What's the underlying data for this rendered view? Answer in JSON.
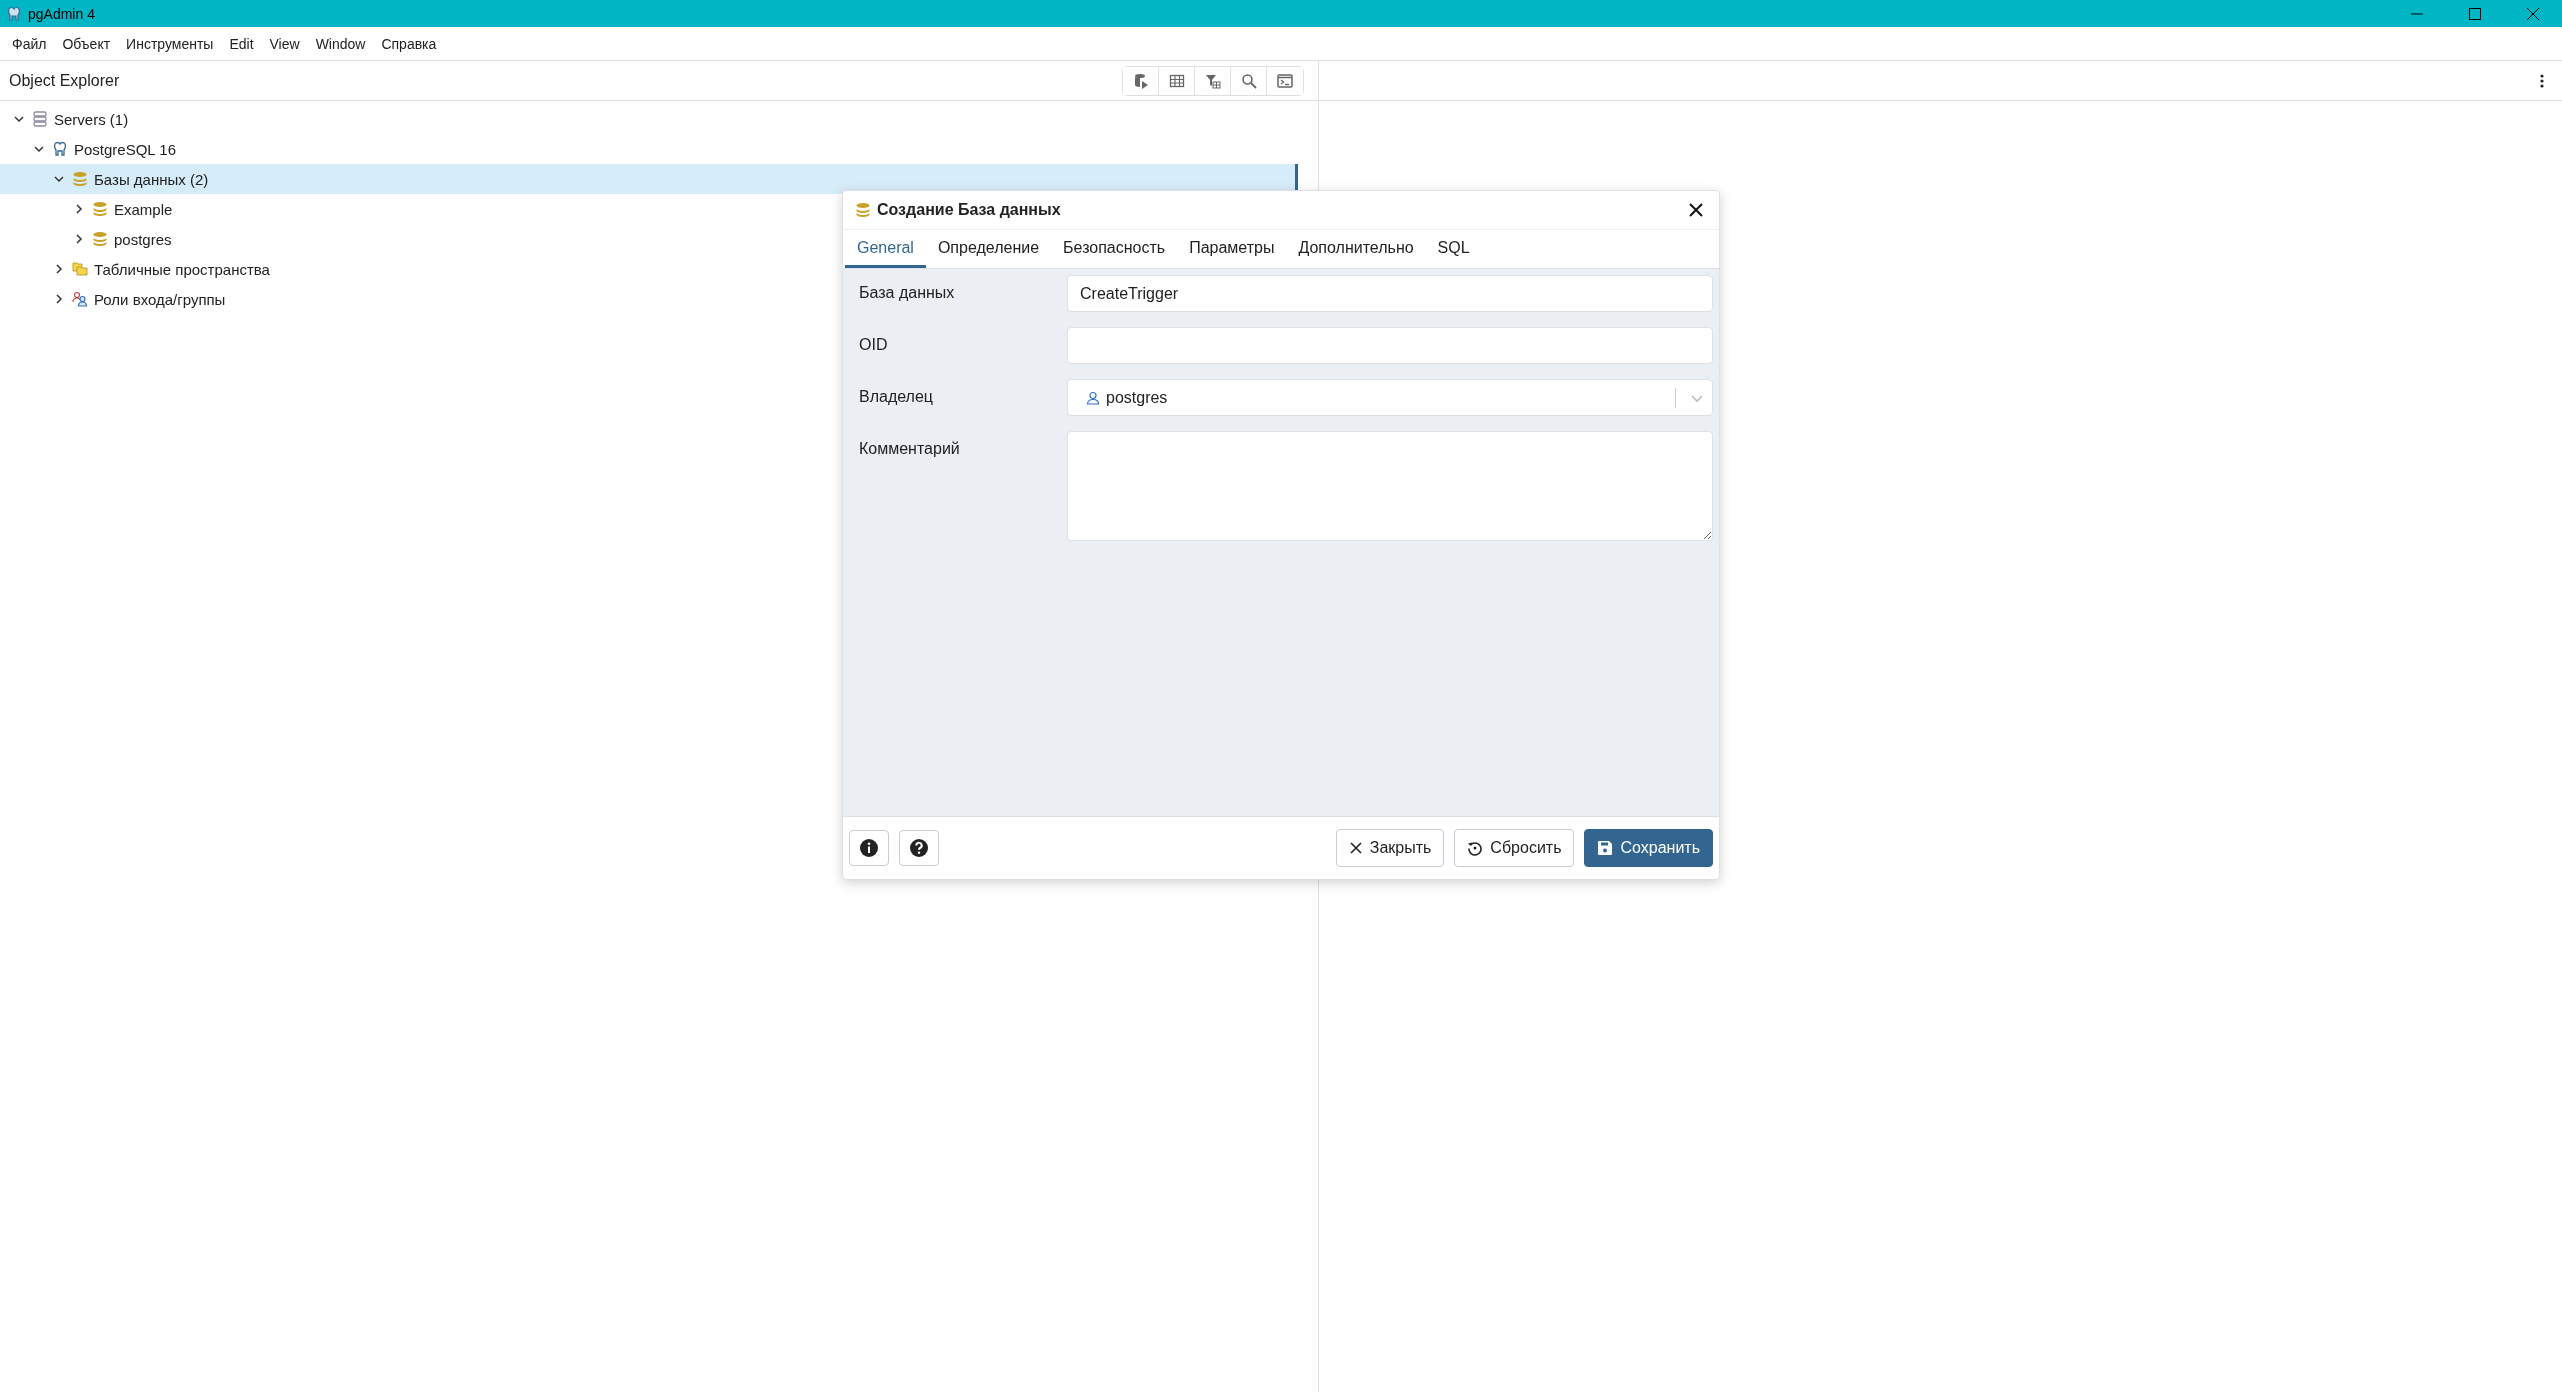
{
  "window": {
    "title": "pgAdmin 4"
  },
  "menu": [
    "Файл",
    "Объект",
    "Инструменты",
    "Edit",
    "View",
    "Window",
    "Справка"
  ],
  "object_explorer": {
    "title": "Object Explorer",
    "tree": [
      {
        "label": "Servers (1)",
        "kind": "server-group",
        "expanded": true,
        "selected": false,
        "children": [
          {
            "label": "PostgreSQL 16",
            "kind": "server",
            "expanded": true,
            "selected": false,
            "children": [
              {
                "label": "Базы данных (2)",
                "kind": "databases",
                "expanded": true,
                "selected": true,
                "children": [
                  {
                    "label": "Example",
                    "kind": "database",
                    "expanded": false,
                    "selected": false
                  },
                  {
                    "label": "postgres",
                    "kind": "database",
                    "expanded": false,
                    "selected": false
                  }
                ]
              },
              {
                "label": "Табличные пространства",
                "kind": "tablespaces",
                "expanded": false,
                "selected": false
              },
              {
                "label": "Роли входа/группы",
                "kind": "roles",
                "expanded": false,
                "selected": false
              }
            ]
          }
        ]
      }
    ]
  },
  "dialog": {
    "title": "Создание База данных",
    "tabs": [
      {
        "label": "General",
        "selected": true
      },
      {
        "label": "Определение",
        "selected": false
      },
      {
        "label": "Безопасность",
        "selected": false
      },
      {
        "label": "Параметры",
        "selected": false
      },
      {
        "label": "Дополнительно",
        "selected": false
      },
      {
        "label": "SQL",
        "selected": false
      }
    ],
    "fields": [
      {
        "kind": "text",
        "label": "База данных",
        "value": "CreateTrigger"
      },
      {
        "kind": "text",
        "label": "OID"
      },
      {
        "kind": "select",
        "label": "Владелец",
        "value": "postgres"
      },
      {
        "kind": "textarea",
        "label": "Комментарий"
      }
    ],
    "buttons": [
      {
        "kind": "close",
        "label": "Закрыть"
      },
      {
        "kind": "reset",
        "label": "Сбросить"
      },
      {
        "kind": "save",
        "label": "Сохранить"
      }
    ]
  }
}
